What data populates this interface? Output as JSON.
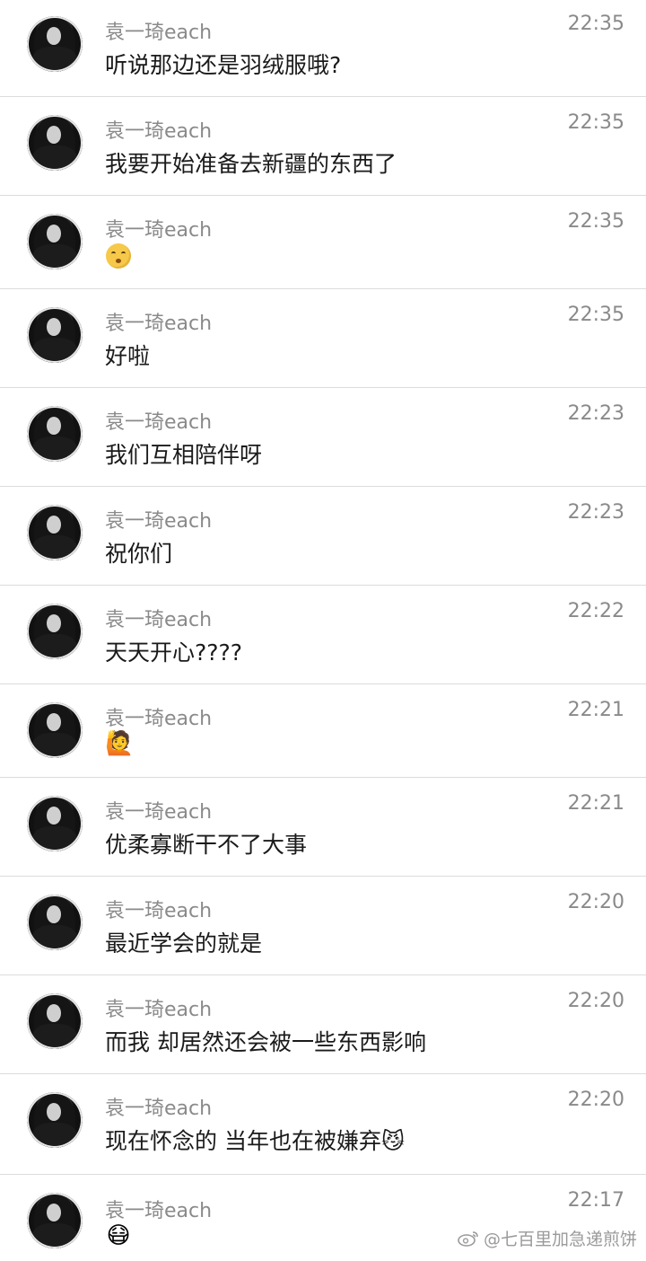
{
  "messages": [
    {
      "sender": "袁一琦each",
      "time": "22:35",
      "text": "听说那边还是羽绒服哦?",
      "emoji": ""
    },
    {
      "sender": "袁一琦each",
      "time": "22:35",
      "text": "我要开始准备去新疆的东西了",
      "emoji": ""
    },
    {
      "sender": "袁一琦each",
      "time": "22:35",
      "text": "",
      "emoji": "😚"
    },
    {
      "sender": "袁一琦each",
      "time": "22:35",
      "text": "好啦",
      "emoji": ""
    },
    {
      "sender": "袁一琦each",
      "time": "22:23",
      "text": "我们互相陪伴呀",
      "emoji": ""
    },
    {
      "sender": "袁一琦each",
      "time": "22:23",
      "text": "祝你们",
      "emoji": ""
    },
    {
      "sender": "袁一琦each",
      "time": "22:22",
      "text": "天天开心????",
      "emoji": ""
    },
    {
      "sender": "袁一琦each",
      "time": "22:21",
      "text": "",
      "emoji": "🙋"
    },
    {
      "sender": "袁一琦each",
      "time": "22:21",
      "text": "优柔寡断干不了大事",
      "emoji": ""
    },
    {
      "sender": "袁一琦each",
      "time": "22:20",
      "text": "最近学会的就是",
      "emoji": ""
    },
    {
      "sender": "袁一琦each",
      "time": "22:20",
      "text": "而我 却居然还会被一些东西影响",
      "emoji": ""
    },
    {
      "sender": "袁一琦each",
      "time": "22:20",
      "text": "现在怀念的 当年也在被嫌弃",
      "emoji": "😼"
    },
    {
      "sender": "袁一琦each",
      "time": "22:17",
      "text": "",
      "emoji": "😷"
    }
  ],
  "watermark": {
    "icon": "weibo-icon",
    "text": "@七百里加急递煎饼"
  }
}
